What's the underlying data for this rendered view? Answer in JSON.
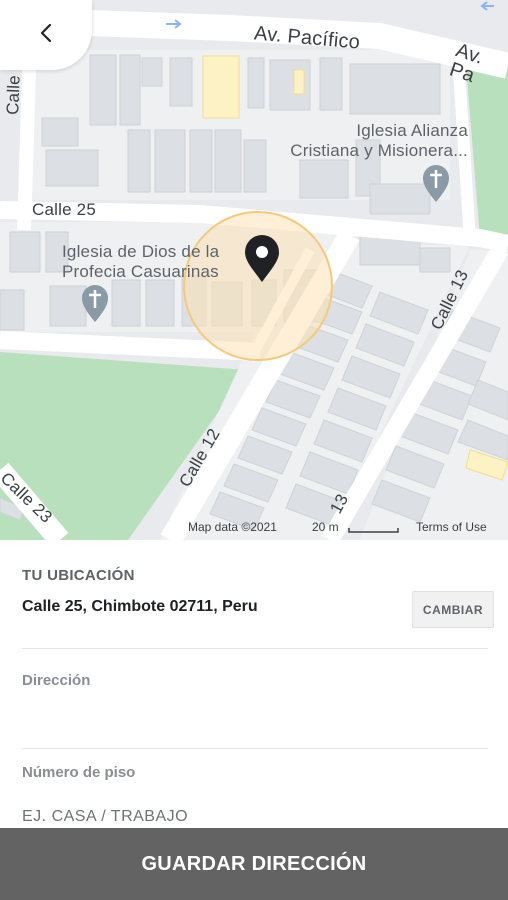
{
  "map": {
    "labels": {
      "street_pacifico_1": "Av. Pacífico",
      "street_pacifico_2": "Av. Pa",
      "street_calle_25": "Calle 25",
      "street_calle_13": "Calle 13",
      "street_calle_12": "Calle 12",
      "street_calle_23": "Calle 23",
      "street_calle_left": "Calle",
      "street_13_bottom": "13",
      "poi_alianza_line1": "Iglesia Alianza",
      "poi_alianza_line2": "Cristiana y Misionera...",
      "poi_dios_line1": "Iglesia de Dios de la",
      "poi_dios_line2": "Profecia Casuarinas"
    },
    "attribution": {
      "map_data": "Map data ©2021",
      "scale": "20 m",
      "terms": "Terms of Use"
    },
    "colors": {
      "park": "#b7dfba",
      "road": "#ffffff",
      "block": "#f1f3f4",
      "building": "#dadce0",
      "highlight": "#fdf2c4",
      "accuracy_circle": "#f5c97c"
    },
    "icons": {
      "back": "chevron-left-icon",
      "pin": "map-pin-icon",
      "church": "church-cross-icon"
    }
  },
  "location": {
    "section_title": "TU UBICACIÓN",
    "address": "Calle 25, Chimbote 02711, Peru",
    "change_label": "CAMBIAR"
  },
  "form": {
    "direccion_label": "Dirección",
    "direccion_value": "",
    "piso_label": "Número de piso",
    "tipo_placeholder": "EJ. CASA / TRABAJO"
  },
  "footer": {
    "save_label": "GUARDAR DIRECCIÓN"
  }
}
